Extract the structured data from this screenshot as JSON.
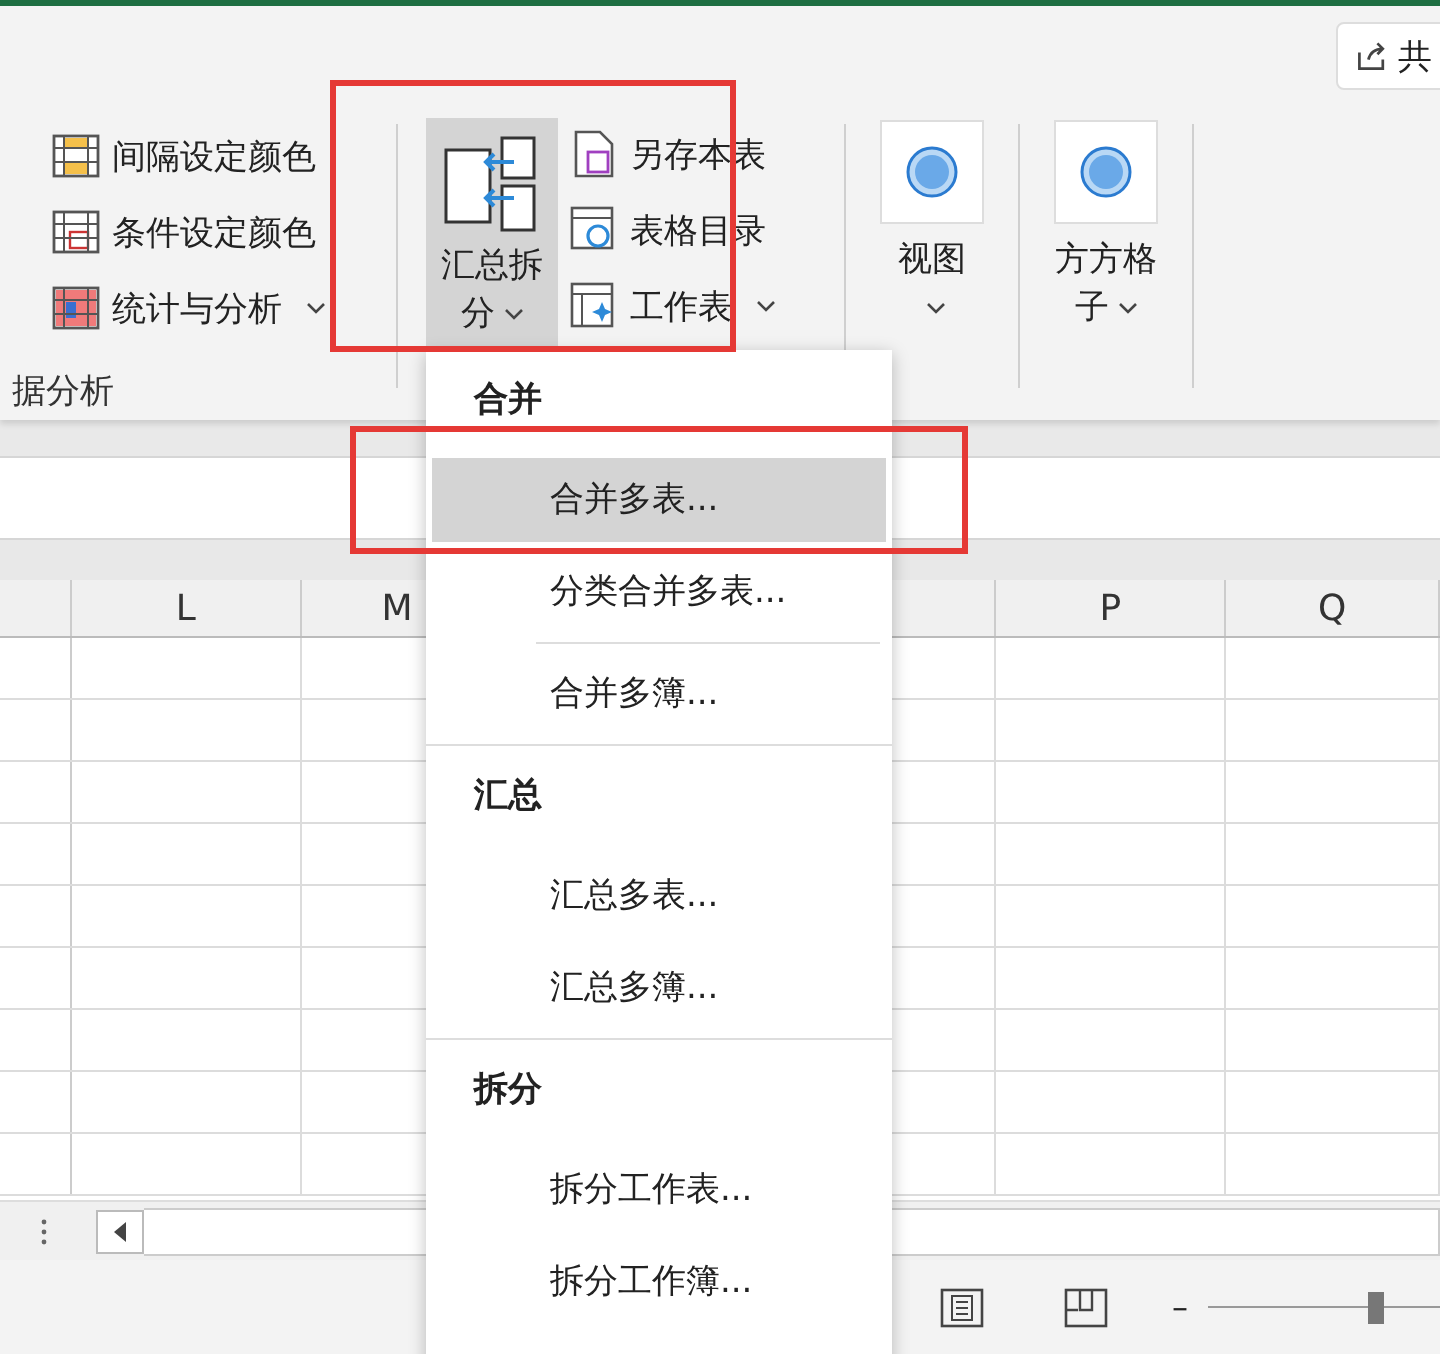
{
  "ribbon": {
    "share_button": {
      "label": "共"
    },
    "color_items": [
      {
        "label": "间隔设定颜色",
        "kind": "interval",
        "has_menu": false
      },
      {
        "label": "条件设定颜色",
        "kind": "condition",
        "has_menu": false
      },
      {
        "label": "统计与分析",
        "kind": "stats",
        "has_menu": true
      }
    ],
    "group_label": "据分析",
    "split_button": {
      "label": "汇总拆分",
      "pressed": true
    },
    "sheet_items": [
      {
        "label": "另存本表",
        "kind": "save",
        "has_menu": false
      },
      {
        "label": "表格目录",
        "kind": "index",
        "has_menu": false
      },
      {
        "label": "工作表",
        "kind": "sheet",
        "has_menu": true
      }
    ],
    "big_buttons": [
      {
        "label": "视图"
      },
      {
        "label": "方方格子"
      }
    ]
  },
  "sheet": {
    "left_columns": [
      "L",
      "M"
    ],
    "right_columns": [
      "P",
      "Q"
    ]
  },
  "menu": {
    "sections": [
      {
        "title": "合并",
        "items": [
          {
            "label": "合并多表...",
            "selected": true,
            "divider_after": false
          },
          {
            "label": "分类合并多表...",
            "selected": false,
            "divider_after": true
          },
          {
            "label": "合并多簿...",
            "selected": false,
            "divider_after": false
          }
        ]
      },
      {
        "title": "汇总",
        "items": [
          {
            "label": "汇总多表...",
            "selected": false,
            "divider_after": false
          },
          {
            "label": "汇总多簿...",
            "selected": false,
            "divider_after": false
          }
        ]
      },
      {
        "title": "拆分",
        "items": [
          {
            "label": "拆分工作表...",
            "selected": false,
            "divider_after": false
          },
          {
            "label": "拆分工作簿...",
            "selected": false,
            "divider_after": false
          }
        ]
      }
    ]
  },
  "status_bar": {
    "zoom_out": "–",
    "zoom_slider": {
      "level": 0.54
    }
  }
}
